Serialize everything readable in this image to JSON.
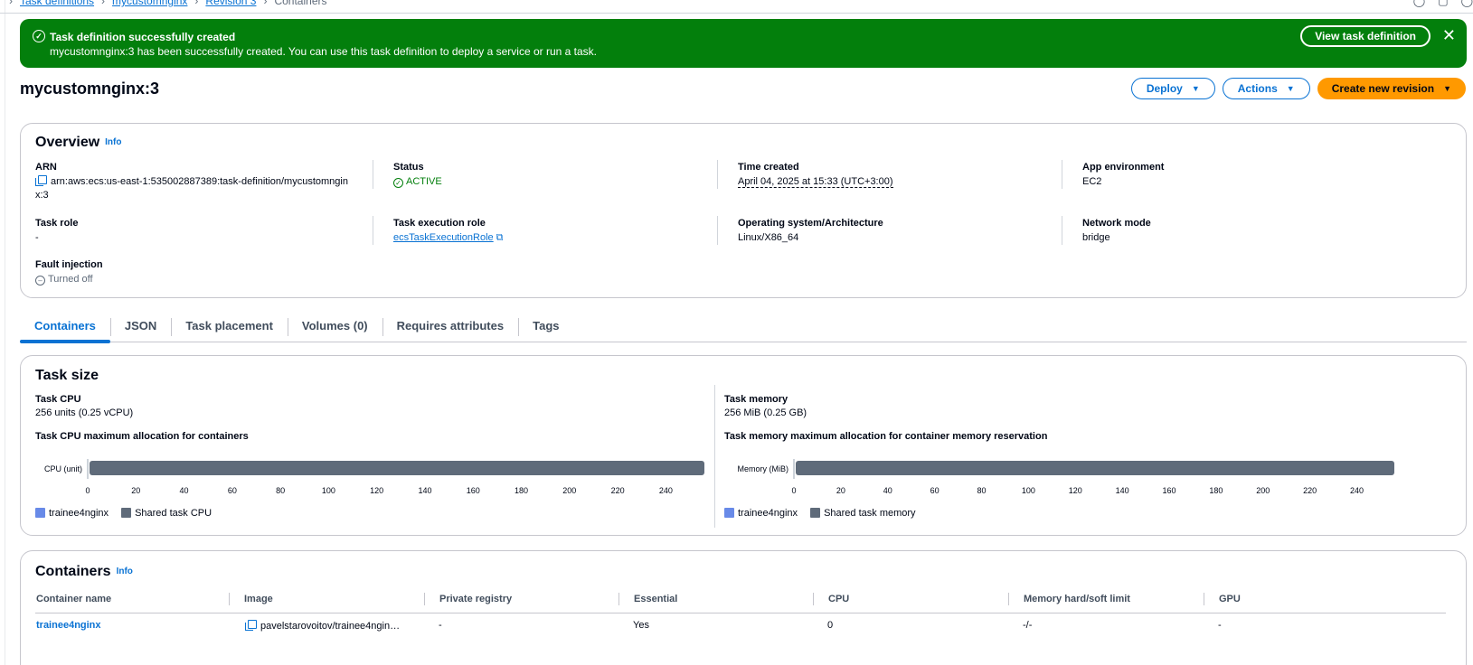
{
  "breadcrumb": {
    "items": [
      "Task definitions",
      "mycustomnginx",
      "Revision 3"
    ],
    "current": "Containers"
  },
  "flash": {
    "title": "Task definition successfully created",
    "message": "mycustomnginx:3 has been successfully created. You can use this task definition to deploy a service or run a task.",
    "button": "View task definition",
    "close": "✕",
    "color": "#037f0c"
  },
  "header": {
    "title": "mycustomnginx:3",
    "deploy": "Deploy",
    "actions": "Actions",
    "create": "Create new revision"
  },
  "overview": {
    "title": "Overview",
    "info": "Info",
    "arn_label": "ARN",
    "arn_value": "arn:aws:ecs:us-east-1:535002887389:task-definition/mycustomnginx:3",
    "status_label": "Status",
    "status_value": "ACTIVE",
    "time_label": "Time created",
    "time_value": "April 04, 2025 at 15:33 (UTC+3:00)",
    "env_label": "App environment",
    "env_value": "EC2",
    "role_label": "Task role",
    "role_value": "-",
    "exec_label": "Task execution role",
    "exec_value": "ecsTaskExecutionRole",
    "os_label": "Operating system/Architecture",
    "os_value": "Linux/X86_64",
    "net_label": "Network mode",
    "net_value": "bridge",
    "fault_label": "Fault injection",
    "fault_value": "Turned off"
  },
  "tabs": [
    "Containers",
    "JSON",
    "Task placement",
    "Volumes (0)",
    "Requires attributes",
    "Tags"
  ],
  "task_size": {
    "title": "Task size",
    "cpu_label": "Task CPU",
    "cpu_value": "256 units (0.25 vCPU)",
    "cpu_alloc_label": "Task CPU maximum allocation for containers",
    "mem_label": "Task memory",
    "mem_value": "256 MiB (0.25 GB)",
    "mem_alloc_label": "Task memory maximum allocation for container memory reservation"
  },
  "chart_data": [
    {
      "type": "bar",
      "orientation": "horizontal",
      "stacked": true,
      "categories": [
        "CPU (unit)"
      ],
      "series": [
        {
          "name": "trainee4nginx",
          "values": [
            0
          ],
          "color": "#688ae8"
        },
        {
          "name": "Shared task CPU",
          "values": [
            256
          ],
          "color": "#5f6b7a"
        }
      ],
      "xticks": [
        0,
        20,
        40,
        60,
        80,
        100,
        120,
        140,
        160,
        180,
        200,
        220,
        240
      ],
      "xlim": [
        0,
        256
      ],
      "legend": "bottom-left"
    },
    {
      "type": "bar",
      "orientation": "horizontal",
      "stacked": true,
      "categories": [
        "Memory (MiB)"
      ],
      "series": [
        {
          "name": "trainee4nginx",
          "values": [
            0
          ],
          "color": "#688ae8"
        },
        {
          "name": "Shared task memory",
          "values": [
            256
          ],
          "color": "#5f6b7a"
        }
      ],
      "xticks": [
        0,
        20,
        40,
        60,
        80,
        100,
        120,
        140,
        160,
        180,
        200,
        220,
        240
      ],
      "xlim": [
        0,
        256
      ],
      "legend": "bottom-left"
    }
  ],
  "containers": {
    "title": "Containers",
    "info": "Info",
    "columns": [
      "Container name",
      "Image",
      "Private registry",
      "Essential",
      "CPU",
      "Memory hard/soft limit",
      "GPU"
    ],
    "rows": [
      [
        "trainee4nginx",
        "pavelstarovoitov/trainee4ngin…",
        "-",
        "Yes",
        "0",
        "-/-",
        "-"
      ]
    ]
  }
}
